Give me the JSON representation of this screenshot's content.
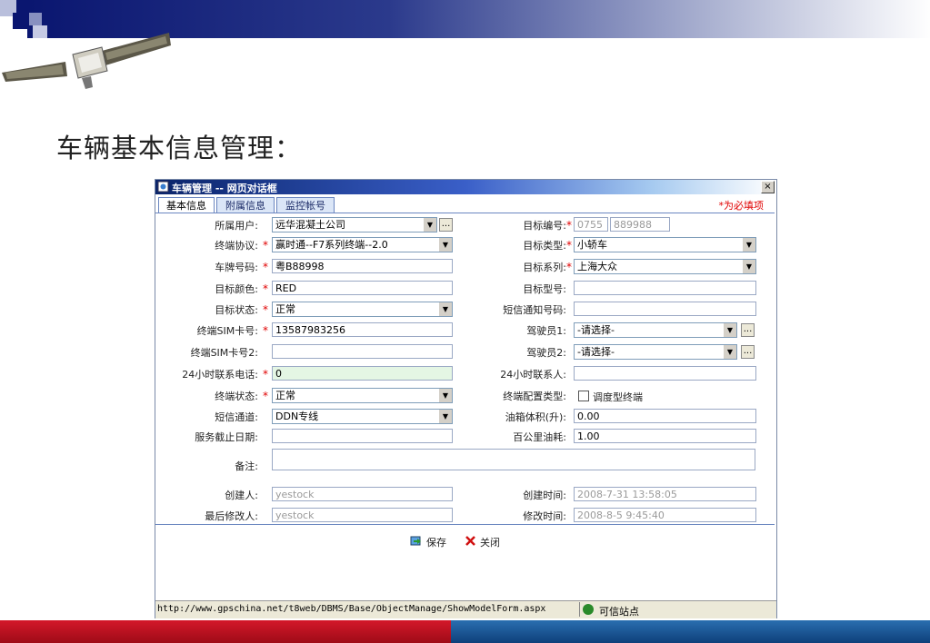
{
  "slide": {
    "title": "车辆基本信息管理："
  },
  "dialog": {
    "title": "车辆管理 -- 网页对话框",
    "close_label": "×",
    "tabs": [
      {
        "label": "基本信息",
        "active": true
      },
      {
        "label": "附属信息",
        "active": false
      },
      {
        "label": "监控帐号",
        "active": false
      }
    ],
    "required_note": "*为必填项",
    "star": "*",
    "arrow": "▼",
    "dots": "...",
    "left_fields": {
      "owner_user": {
        "label": "所属用户:",
        "value": "远华混凝土公司"
      },
      "terminal_protocol": {
        "label": "终端协议:",
        "value": "赢时通--F7系列终端--2.0"
      },
      "plate_number": {
        "label": "车牌号码:",
        "value": "粤B88998"
      },
      "target_color": {
        "label": "目标颜色:",
        "value": "RED"
      },
      "target_status": {
        "label": "目标状态:",
        "value": "正常"
      },
      "sim_number": {
        "label": "终端SIM卡号:",
        "value": "13587983256"
      },
      "sim_number_2": {
        "label": "终端SIM卡号2:",
        "value": ""
      },
      "hotline_24h": {
        "label": "24小时联系电话:",
        "value": "0"
      },
      "terminal_status": {
        "label": "终端状态:",
        "value": "正常"
      },
      "sms_channel": {
        "label": "短信通道:",
        "value": "DDN专线"
      },
      "service_end_date": {
        "label": "服务截止日期:",
        "value": ""
      }
    },
    "right_fields": {
      "target_number": {
        "label": "目标编号:",
        "value_prefix": "0755",
        "value": "889988"
      },
      "target_type": {
        "label": "目标类型:",
        "value": "小轿车"
      },
      "target_series": {
        "label": "目标系列:",
        "value": "上海大众"
      },
      "target_model": {
        "label": "目标型号:",
        "value": ""
      },
      "sms_notify_number": {
        "label": "短信通知号码:",
        "value": ""
      },
      "driver_1": {
        "label": "驾驶员1:",
        "value": "-请选择-"
      },
      "driver_2": {
        "label": "驾驶员2:",
        "value": "-请选择-"
      },
      "contact_24h": {
        "label": "24小时联系人:",
        "value": ""
      },
      "terminal_config_type": {
        "label": "终端配置类型:",
        "checkbox_label": "调度型终端",
        "checked": false
      },
      "tank_volume": {
        "label": "油箱体积(升):",
        "value": "0.00"
      },
      "fuel_per_100km": {
        "label": "百公里油耗:",
        "value": "1.00"
      }
    },
    "remarks": {
      "label": "备注:",
      "value": ""
    },
    "creator": {
      "label": "创建人:",
      "value": "yestock"
    },
    "last_modifier": {
      "label": "最后修改人:",
      "value": "yestock"
    },
    "created_time": {
      "label": "创建时间:",
      "value": "2008-7-31 13:58:05"
    },
    "modified_time": {
      "label": "修改时间:",
      "value": "2008-8-5 9:45:40"
    },
    "save_label": "保存",
    "close_button_label": "关闭",
    "status_url": "http://www.gpschina.net/t8web/DBMS/Base/ObjectManage/ShowModelForm.aspx",
    "status_trusted": "可信站点",
    "colors": {
      "required": "#e00000",
      "titlebar": "#0a246a",
      "bottom_red": "#d4182a",
      "bottom_blue": "#0e3f7a"
    }
  }
}
